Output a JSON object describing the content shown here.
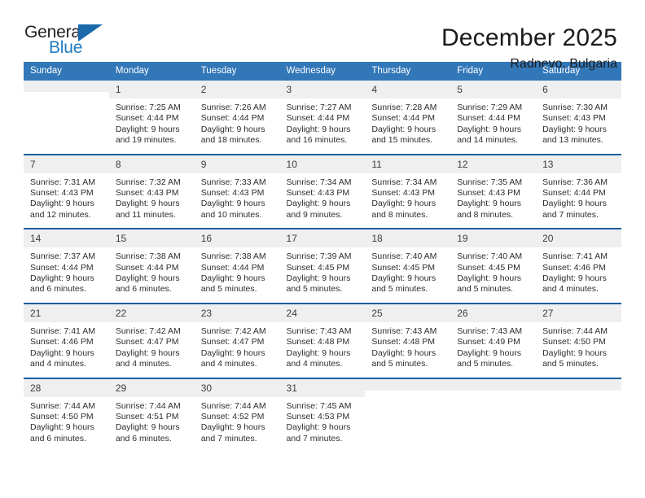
{
  "logo": {
    "word1": "General",
    "word2": "Blue",
    "triangle_color": "#1a6aab",
    "word2_color": "#1f7ac0"
  },
  "header": {
    "title": "December 2025",
    "subtitle": "Radnevo, Bulgaria"
  },
  "colors": {
    "header_blue": "#3277b8",
    "row_divider_blue": "#1b5f9e",
    "daynum_band": "#efefef"
  },
  "weekday_headers": [
    "Sunday",
    "Monday",
    "Tuesday",
    "Wednesday",
    "Thursday",
    "Friday",
    "Saturday"
  ],
  "weeks": [
    [
      {
        "day": "",
        "blank": true,
        "sunrise": "",
        "sunset": "",
        "daylight1": "",
        "daylight2": ""
      },
      {
        "day": "1",
        "sunrise": "Sunrise: 7:25 AM",
        "sunset": "Sunset: 4:44 PM",
        "daylight1": "Daylight: 9 hours",
        "daylight2": "and 19 minutes."
      },
      {
        "day": "2",
        "sunrise": "Sunrise: 7:26 AM",
        "sunset": "Sunset: 4:44 PM",
        "daylight1": "Daylight: 9 hours",
        "daylight2": "and 18 minutes."
      },
      {
        "day": "3",
        "sunrise": "Sunrise: 7:27 AM",
        "sunset": "Sunset: 4:44 PM",
        "daylight1": "Daylight: 9 hours",
        "daylight2": "and 16 minutes."
      },
      {
        "day": "4",
        "sunrise": "Sunrise: 7:28 AM",
        "sunset": "Sunset: 4:44 PM",
        "daylight1": "Daylight: 9 hours",
        "daylight2": "and 15 minutes."
      },
      {
        "day": "5",
        "sunrise": "Sunrise: 7:29 AM",
        "sunset": "Sunset: 4:44 PM",
        "daylight1": "Daylight: 9 hours",
        "daylight2": "and 14 minutes."
      },
      {
        "day": "6",
        "sunrise": "Sunrise: 7:30 AM",
        "sunset": "Sunset: 4:43 PM",
        "daylight1": "Daylight: 9 hours",
        "daylight2": "and 13 minutes."
      }
    ],
    [
      {
        "day": "7",
        "sunrise": "Sunrise: 7:31 AM",
        "sunset": "Sunset: 4:43 PM",
        "daylight1": "Daylight: 9 hours",
        "daylight2": "and 12 minutes."
      },
      {
        "day": "8",
        "sunrise": "Sunrise: 7:32 AM",
        "sunset": "Sunset: 4:43 PM",
        "daylight1": "Daylight: 9 hours",
        "daylight2": "and 11 minutes."
      },
      {
        "day": "9",
        "sunrise": "Sunrise: 7:33 AM",
        "sunset": "Sunset: 4:43 PM",
        "daylight1": "Daylight: 9 hours",
        "daylight2": "and 10 minutes."
      },
      {
        "day": "10",
        "sunrise": "Sunrise: 7:34 AM",
        "sunset": "Sunset: 4:43 PM",
        "daylight1": "Daylight: 9 hours",
        "daylight2": "and 9 minutes."
      },
      {
        "day": "11",
        "sunrise": "Sunrise: 7:34 AM",
        "sunset": "Sunset: 4:43 PM",
        "daylight1": "Daylight: 9 hours",
        "daylight2": "and 8 minutes."
      },
      {
        "day": "12",
        "sunrise": "Sunrise: 7:35 AM",
        "sunset": "Sunset: 4:43 PM",
        "daylight1": "Daylight: 9 hours",
        "daylight2": "and 8 minutes."
      },
      {
        "day": "13",
        "sunrise": "Sunrise: 7:36 AM",
        "sunset": "Sunset: 4:44 PM",
        "daylight1": "Daylight: 9 hours",
        "daylight2": "and 7 minutes."
      }
    ],
    [
      {
        "day": "14",
        "sunrise": "Sunrise: 7:37 AM",
        "sunset": "Sunset: 4:44 PM",
        "daylight1": "Daylight: 9 hours",
        "daylight2": "and 6 minutes."
      },
      {
        "day": "15",
        "sunrise": "Sunrise: 7:38 AM",
        "sunset": "Sunset: 4:44 PM",
        "daylight1": "Daylight: 9 hours",
        "daylight2": "and 6 minutes."
      },
      {
        "day": "16",
        "sunrise": "Sunrise: 7:38 AM",
        "sunset": "Sunset: 4:44 PM",
        "daylight1": "Daylight: 9 hours",
        "daylight2": "and 5 minutes."
      },
      {
        "day": "17",
        "sunrise": "Sunrise: 7:39 AM",
        "sunset": "Sunset: 4:45 PM",
        "daylight1": "Daylight: 9 hours",
        "daylight2": "and 5 minutes."
      },
      {
        "day": "18",
        "sunrise": "Sunrise: 7:40 AM",
        "sunset": "Sunset: 4:45 PM",
        "daylight1": "Daylight: 9 hours",
        "daylight2": "and 5 minutes."
      },
      {
        "day": "19",
        "sunrise": "Sunrise: 7:40 AM",
        "sunset": "Sunset: 4:45 PM",
        "daylight1": "Daylight: 9 hours",
        "daylight2": "and 5 minutes."
      },
      {
        "day": "20",
        "sunrise": "Sunrise: 7:41 AM",
        "sunset": "Sunset: 4:46 PM",
        "daylight1": "Daylight: 9 hours",
        "daylight2": "and 4 minutes."
      }
    ],
    [
      {
        "day": "21",
        "sunrise": "Sunrise: 7:41 AM",
        "sunset": "Sunset: 4:46 PM",
        "daylight1": "Daylight: 9 hours",
        "daylight2": "and 4 minutes."
      },
      {
        "day": "22",
        "sunrise": "Sunrise: 7:42 AM",
        "sunset": "Sunset: 4:47 PM",
        "daylight1": "Daylight: 9 hours",
        "daylight2": "and 4 minutes."
      },
      {
        "day": "23",
        "sunrise": "Sunrise: 7:42 AM",
        "sunset": "Sunset: 4:47 PM",
        "daylight1": "Daylight: 9 hours",
        "daylight2": "and 4 minutes."
      },
      {
        "day": "24",
        "sunrise": "Sunrise: 7:43 AM",
        "sunset": "Sunset: 4:48 PM",
        "daylight1": "Daylight: 9 hours",
        "daylight2": "and 4 minutes."
      },
      {
        "day": "25",
        "sunrise": "Sunrise: 7:43 AM",
        "sunset": "Sunset: 4:48 PM",
        "daylight1": "Daylight: 9 hours",
        "daylight2": "and 5 minutes."
      },
      {
        "day": "26",
        "sunrise": "Sunrise: 7:43 AM",
        "sunset": "Sunset: 4:49 PM",
        "daylight1": "Daylight: 9 hours",
        "daylight2": "and 5 minutes."
      },
      {
        "day": "27",
        "sunrise": "Sunrise: 7:44 AM",
        "sunset": "Sunset: 4:50 PM",
        "daylight1": "Daylight: 9 hours",
        "daylight2": "and 5 minutes."
      }
    ],
    [
      {
        "day": "28",
        "sunrise": "Sunrise: 7:44 AM",
        "sunset": "Sunset: 4:50 PM",
        "daylight1": "Daylight: 9 hours",
        "daylight2": "and 6 minutes."
      },
      {
        "day": "29",
        "sunrise": "Sunrise: 7:44 AM",
        "sunset": "Sunset: 4:51 PM",
        "daylight1": "Daylight: 9 hours",
        "daylight2": "and 6 minutes."
      },
      {
        "day": "30",
        "sunrise": "Sunrise: 7:44 AM",
        "sunset": "Sunset: 4:52 PM",
        "daylight1": "Daylight: 9 hours",
        "daylight2": "and 7 minutes."
      },
      {
        "day": "31",
        "sunrise": "Sunrise: 7:45 AM",
        "sunset": "Sunset: 4:53 PM",
        "daylight1": "Daylight: 9 hours",
        "daylight2": "and 7 minutes."
      },
      {
        "day": "",
        "blank": true,
        "sunrise": "",
        "sunset": "",
        "daylight1": "",
        "daylight2": ""
      },
      {
        "day": "",
        "blank": true,
        "sunrise": "",
        "sunset": "",
        "daylight1": "",
        "daylight2": ""
      },
      {
        "day": "",
        "blank": true,
        "sunrise": "",
        "sunset": "",
        "daylight1": "",
        "daylight2": ""
      }
    ]
  ]
}
